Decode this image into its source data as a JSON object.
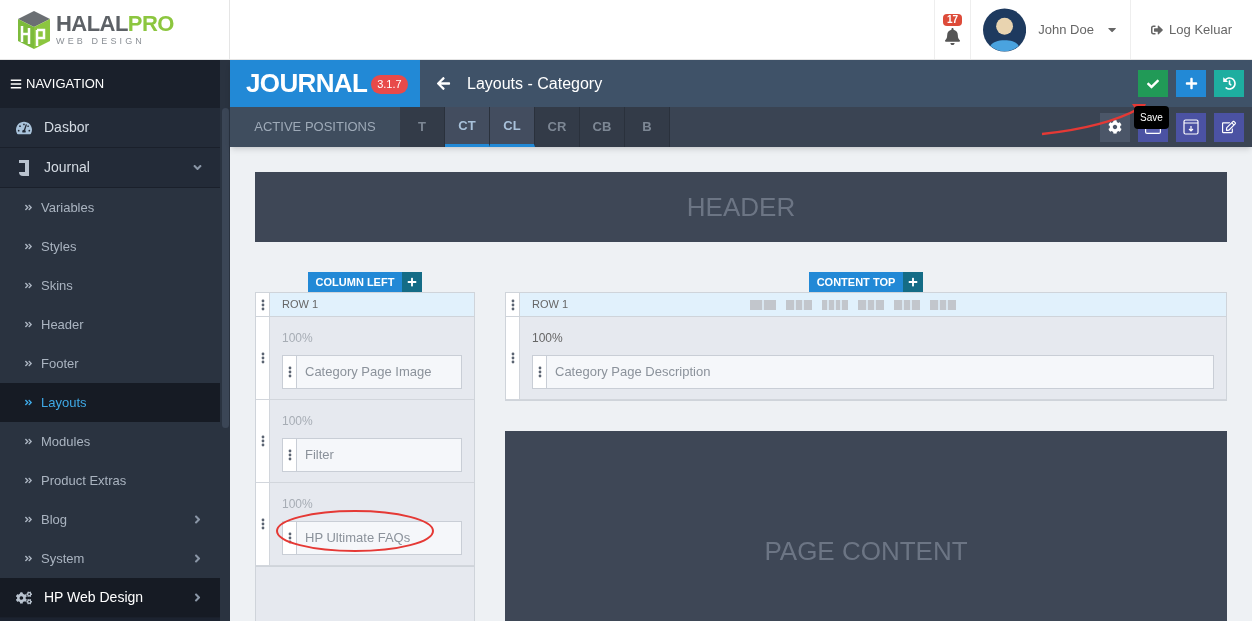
{
  "brand": {
    "name_dark": "HALAL",
    "name_accent": "PRO",
    "tagline": "WEB DESIGN"
  },
  "header": {
    "notifications": "17",
    "user": "John Doe",
    "logout": "Log Keluar"
  },
  "sidebar": {
    "title": "NAVIGATION",
    "items": [
      {
        "label": "Dasbor",
        "kind": "link",
        "selected": false
      },
      {
        "label": "Journal",
        "kind": "group",
        "selected": false,
        "expanded": true,
        "children": [
          {
            "label": "Variables",
            "kind": "link",
            "selected": false
          },
          {
            "label": "Styles",
            "kind": "link",
            "selected": false
          },
          {
            "label": "Skins",
            "kind": "link",
            "selected": false
          },
          {
            "label": "Header",
            "kind": "link",
            "selected": false
          },
          {
            "label": "Footer",
            "kind": "link",
            "selected": false
          },
          {
            "label": "Layouts",
            "kind": "link",
            "selected": true
          },
          {
            "label": "Modules",
            "kind": "link",
            "selected": false
          },
          {
            "label": "Product Extras",
            "kind": "link",
            "selected": false
          },
          {
            "label": "Blog",
            "kind": "group",
            "selected": false,
            "expanded": false
          },
          {
            "label": "System",
            "kind": "group",
            "selected": false,
            "expanded": false
          }
        ]
      },
      {
        "label": "HP Web Design",
        "kind": "group",
        "selected": false,
        "expanded": false
      }
    ]
  },
  "topbar": {
    "logo": "JOURNAL",
    "version": "3.1.7",
    "title": "Layouts - Category",
    "tooltip": "Save"
  },
  "positions": {
    "label": "ACTIVE POSITIONS",
    "tabs": [
      {
        "label": "T",
        "selected": false
      },
      {
        "label": "CT",
        "selected": true
      },
      {
        "label": "CL",
        "selected": true
      },
      {
        "label": "CR",
        "selected": false
      },
      {
        "label": "CB",
        "selected": false
      },
      {
        "label": "B",
        "selected": false
      }
    ]
  },
  "layout": {
    "header": "HEADER",
    "column_left": {
      "title": "COLUMN LEFT",
      "row": "ROW 1",
      "cells": [
        {
          "percent": "100%",
          "module": "Category Page Image",
          "circled": false
        },
        {
          "percent": "100%",
          "module": "Filter",
          "circled": false
        },
        {
          "percent": "100%",
          "module": "HP Ultimate FAQs",
          "circled": true
        }
      ]
    },
    "content_top": {
      "title": "CONTENT TOP",
      "row": "ROW 1",
      "cells": [
        {
          "percent": "100%",
          "module": "Category Page Description",
          "circled": false
        }
      ]
    },
    "page_content": "PAGE CONTENT"
  }
}
